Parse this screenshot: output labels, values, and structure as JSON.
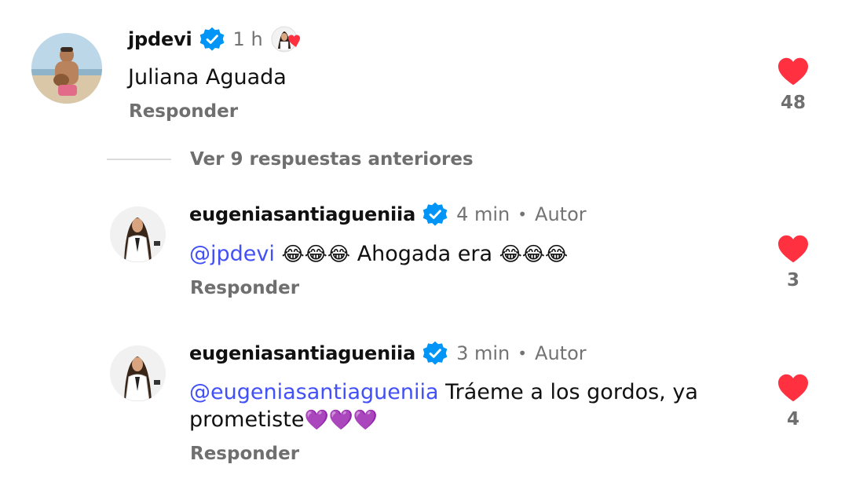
{
  "comments": [
    {
      "username": "jpdevi",
      "time": "1 h",
      "text": "Juliana Aguada",
      "reply_label": "Responder",
      "likes": "48"
    },
    {
      "username": "eugeniasantiagueniia",
      "time": "4 min",
      "separator": "•",
      "author_badge": "Autor",
      "mention": "@jpdevi",
      "text_part1": "😂😂😂",
      "text_part2": " Ahogada era ",
      "text_part3": "😂😂😂",
      "reply_label": "Responder",
      "likes": "3"
    },
    {
      "username": "eugeniasantiagueniia",
      "time": "3 min",
      "separator": "•",
      "author_badge": "Autor",
      "mention": "@eugeniasantiagueniia",
      "text_line1": " Tráeme a los gordos, ya",
      "text_line2": "prometiste",
      "emoji": "💜💜💜",
      "reply_label": "Responder",
      "likes": "4"
    }
  ],
  "more_replies_label": "Ver 9 respuestas anteriores",
  "colors": {
    "heart": "#ff3040",
    "verified": "#0095f6",
    "mention": "#4150f7",
    "secondary_text": "#737373"
  },
  "icons": {
    "verified": "verified-badge-icon",
    "heart": "heart-filled-icon",
    "mention": "threads-at-icon"
  }
}
